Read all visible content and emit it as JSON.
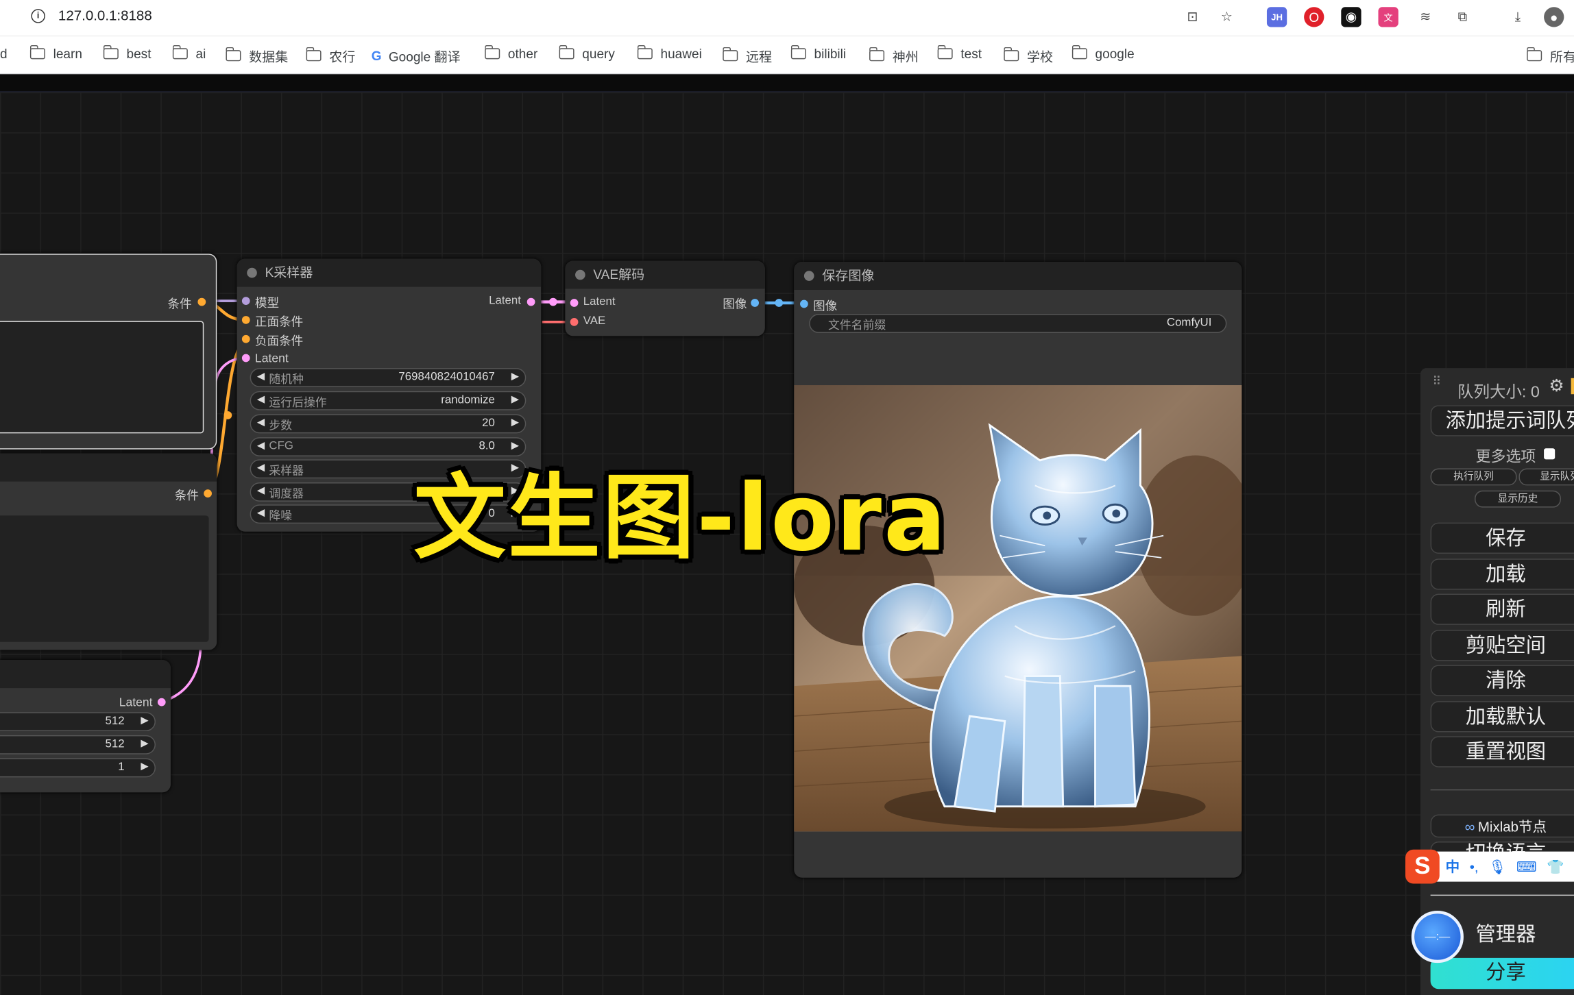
{
  "browser": {
    "url": "127.0.0.1:8188",
    "bookmarks": [
      "d",
      "learn",
      "best",
      "ai",
      "数据集",
      "农行",
      "Google 翻译",
      "other",
      "query",
      "huawei",
      "远程",
      "bilibili",
      "神州",
      "test",
      "学校",
      "google",
      "所有"
    ],
    "extensions": [
      "translate-icon",
      "star-icon",
      "jh-extension-icon",
      "opera-icon",
      "game-icon",
      "translate-ca-icon",
      "tune-icon",
      "puzzle-icon",
      "download-icon",
      "avatar"
    ]
  },
  "nodes": {
    "ksampler": {
      "title": "K采样器",
      "inputs": [
        "模型",
        "正面条件",
        "负面条件",
        "Latent"
      ],
      "output": "Latent",
      "widgets": [
        {
          "label": "随机种",
          "value": "769840824010467"
        },
        {
          "label": "运行后操作",
          "value": "randomize"
        },
        {
          "label": "步数",
          "value": "20"
        },
        {
          "label": "CFG",
          "value": "8.0"
        },
        {
          "label": "采样器",
          "value": ""
        },
        {
          "label": "调度器",
          "value": ""
        },
        {
          "label": "降噪",
          "value": "0"
        }
      ]
    },
    "vae_decode": {
      "title": "VAE解码",
      "inputs": [
        "Latent",
        "VAE"
      ],
      "output": "图像"
    },
    "save_image": {
      "title": "保存图像",
      "input": "图像",
      "widget": {
        "label": "文件名前缀",
        "value": "ComfyUI"
      }
    },
    "clip_pos": {
      "output": "条件"
    },
    "clip_neg": {
      "output": "条件"
    },
    "latent": {
      "output": "Latent",
      "widgets": [
        "512",
        "512",
        "1"
      ]
    }
  },
  "overlay_title": "文生图-lora",
  "queue_panel": {
    "queue_size": "队列大小: 0",
    "add_prompt": "添加提示词队列",
    "more_options": "更多选项",
    "run_queue": "执行队列",
    "show_queue": "显示队列",
    "show_history": "显示历史",
    "buttons": [
      "保存",
      "加载",
      "刷新",
      "剪贴空间",
      "清除",
      "加载默认",
      "重置视图"
    ],
    "mixlab": "Mixlab节点",
    "switch_language": "切换语言",
    "manager": "管理器",
    "share": "分享"
  },
  "ime": {
    "lang": "中"
  },
  "colors": {
    "model": "#b39ddb",
    "conditioning": "#ffa931",
    "latent": "#ff9cf9",
    "vae": "#ff6e6e",
    "image": "#64b5f6",
    "overlay": "#ffe81a"
  }
}
